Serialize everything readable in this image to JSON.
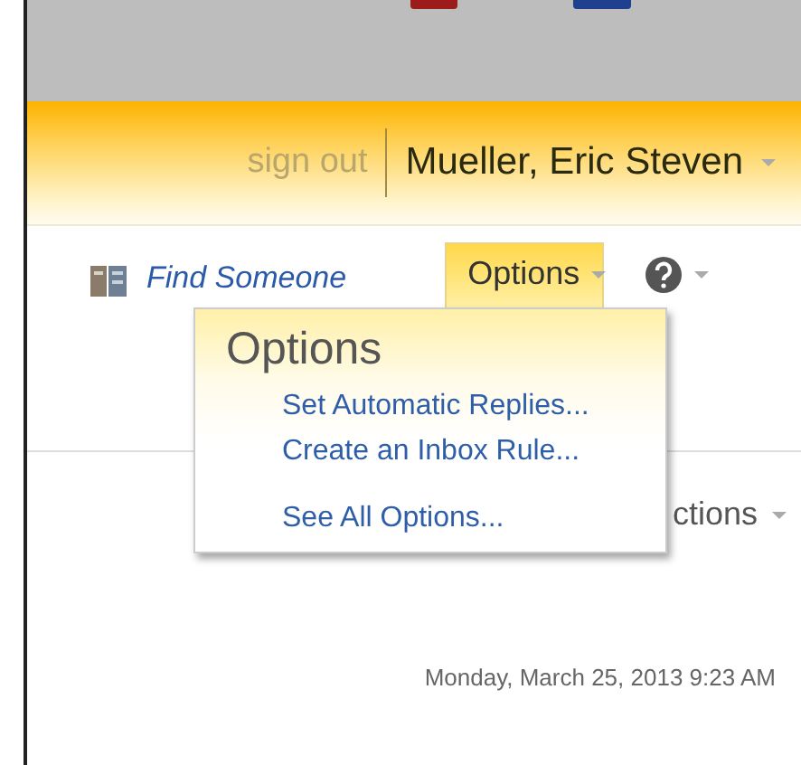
{
  "header": {
    "sign_out": "sign out",
    "user_name": "Mueller, Eric Steven"
  },
  "toolbar": {
    "find_someone": "Find Someone",
    "options": {
      "label": "Options",
      "expanded": true
    }
  },
  "options_menu": {
    "title": "Options",
    "groups": [
      [
        {
          "label": "Set Automatic Replies..."
        },
        {
          "label": "Create an Inbox Rule..."
        }
      ],
      [
        {
          "label": "See All Options..."
        }
      ]
    ]
  },
  "partly_hidden_text": "ctions",
  "date": "Monday, March 25, 2013 9:23 AM"
}
